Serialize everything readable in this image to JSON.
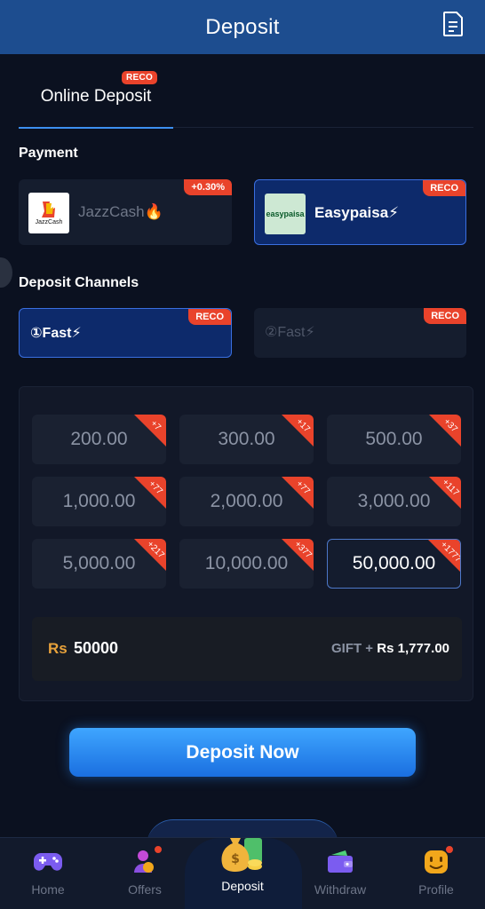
{
  "header": {
    "title": "Deposit",
    "icon": "document-icon"
  },
  "tabs": [
    {
      "label": "Online Deposit",
      "badge": "RECO",
      "active": true
    }
  ],
  "payment": {
    "title": "Payment",
    "methods": [
      {
        "label": "JazzCash🔥",
        "logo_text": "JazzCash",
        "badge": "+0.30%",
        "active": false
      },
      {
        "label": "Easypaisa⚡",
        "logo_text": "easypaisa",
        "badge": "RECO",
        "active": true
      }
    ]
  },
  "channels": {
    "title": "Deposit Channels",
    "items": [
      {
        "label": "①Fast⚡",
        "badge": "RECO",
        "active": true
      },
      {
        "label": "②Fast⚡",
        "badge": "RECO",
        "active": false
      }
    ]
  },
  "amounts": [
    {
      "value": "200.00",
      "bonus": "+7"
    },
    {
      "value": "300.00",
      "bonus": "+17"
    },
    {
      "value": "500.00",
      "bonus": "+37"
    },
    {
      "value": "1,000.00",
      "bonus": "+77"
    },
    {
      "value": "2,000.00",
      "bonus": "+77"
    },
    {
      "value": "3,000.00",
      "bonus": "+117"
    },
    {
      "value": "5,000.00",
      "bonus": "+217"
    },
    {
      "value": "10,000.00",
      "bonus": "+377"
    },
    {
      "value": "50,000.00",
      "bonus": "+1777"
    }
  ],
  "selected_amount_index": 8,
  "summary": {
    "currency": "Rs",
    "amount": "50000",
    "gift_label": "GIFT +",
    "gift_currency": "Rs",
    "gift_amount": "1,777.00"
  },
  "cta": {
    "label": "Deposit Now"
  },
  "bottom_nav": [
    {
      "label": "Home",
      "icon": "gamepad-icon",
      "active": false,
      "dot": false
    },
    {
      "label": "Offers",
      "icon": "offers-gift-icon",
      "active": false,
      "dot": true
    },
    {
      "label": "Deposit",
      "icon": "money-bag-icon",
      "active": true,
      "dot": false
    },
    {
      "label": "Withdraw",
      "icon": "wallet-icon",
      "active": false,
      "dot": false
    },
    {
      "label": "Profile",
      "icon": "smiley-avatar-icon",
      "active": false,
      "dot": true
    }
  ],
  "colors": {
    "header": "#1d4d8f",
    "accent": "#3c8ff0",
    "badge": "#e9432b",
    "currency": "#e8a23b",
    "background": "#0b1120"
  }
}
